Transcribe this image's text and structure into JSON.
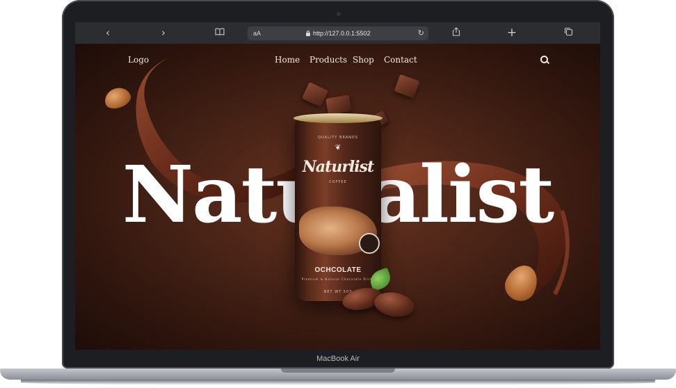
{
  "browser": {
    "back_icon": "chevron-left-icon",
    "forward_icon": "chevron-right-icon",
    "reader_icon": "book-icon",
    "text_size_label": "aA",
    "url": "http://127.0.0.1:5502",
    "reload_icon": "reload-icon",
    "share_icon": "share-icon",
    "new_tab_icon": "plus-icon",
    "tabs_icon": "tabs-icon"
  },
  "site": {
    "logo": "Logo",
    "nav": [
      "Home",
      "Products",
      "Shop",
      "Contact"
    ],
    "search_icon": "search-icon",
    "hero_title": "Naturalist"
  },
  "can": {
    "tagline": "QUALITY BRANDS",
    "brand": "Naturlist",
    "subtitle": "COFFEE",
    "flavor": "OCHCOLATE",
    "fine_print": "Premium & Natural Chocolate Drink",
    "volume": "NET WT 503"
  },
  "device": {
    "label": "MacBook Air"
  },
  "colors": {
    "background": "#3a1b10",
    "text": "#ffffff",
    "browser_bar": "#2c2d31"
  }
}
